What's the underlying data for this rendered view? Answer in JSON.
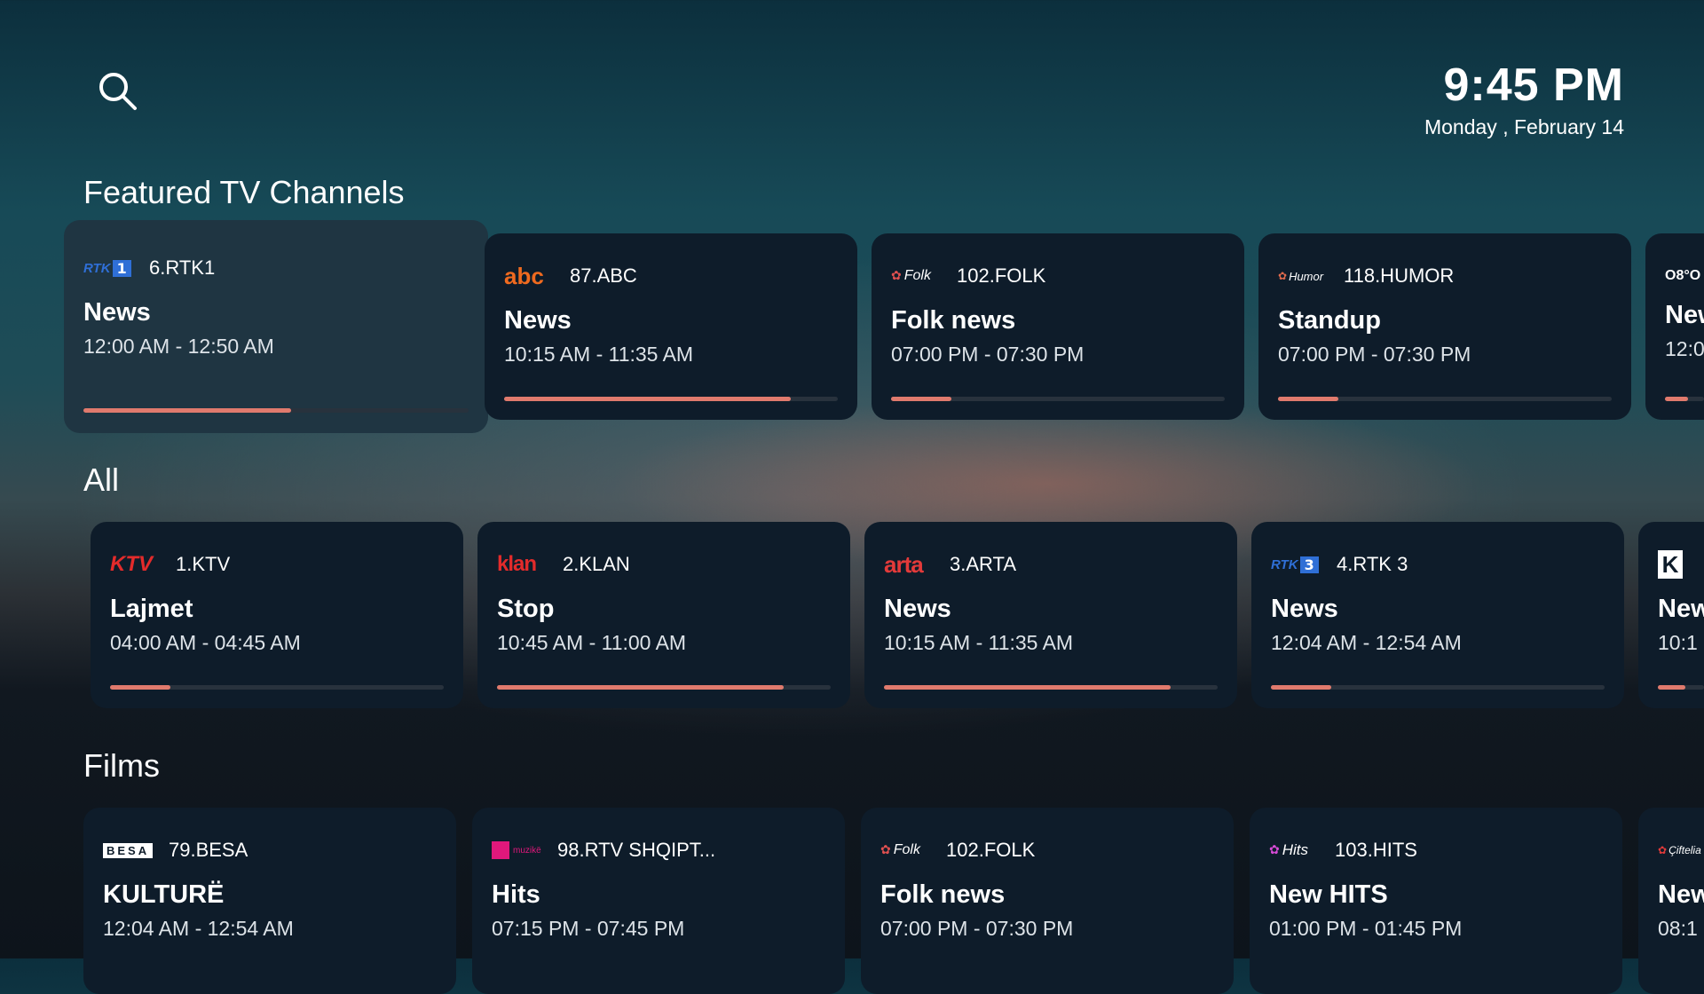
{
  "header": {
    "time": "9:45 PM",
    "date": "Monday , February 14"
  },
  "sections": {
    "featured": {
      "title": "Featured TV Channels",
      "cards": [
        {
          "channel": "6.RTK1",
          "program": "News",
          "times": "12:00 AM - 12:50 AM",
          "progress": 0.54,
          "logo": "rtk1-logo"
        },
        {
          "channel": "87.ABC",
          "program": "News",
          "times": "10:15 AM - 11:35 AM",
          "progress": 0.86,
          "logo": "abc-logo"
        },
        {
          "channel": "102.FOLK",
          "program": "Folk news",
          "times": "07:00 PM - 07:30 PM",
          "progress": 0.18,
          "logo": "folk-logo"
        },
        {
          "channel": "118.HUMOR",
          "program": "Standup",
          "times": "07:00 PM - 07:30 PM",
          "progress": 0.18,
          "logo": "humor-logo"
        },
        {
          "channel": "",
          "program": "New",
          "times": "12:0",
          "progress": 0.6,
          "logo": "oxo-logo"
        }
      ]
    },
    "all": {
      "title": "All",
      "cards": [
        {
          "channel": "1.KTV",
          "program": "Lajmet",
          "times": "04:00 AM - 04:45 AM",
          "progress": 0.18,
          "logo": "ktv-logo"
        },
        {
          "channel": "2.KLAN",
          "program": "Stop",
          "times": "10:45 AM - 11:00 AM",
          "progress": 0.86,
          "logo": "klan-logo"
        },
        {
          "channel": "3.ARTA",
          "program": "News",
          "times": "10:15 AM - 11:35 AM",
          "progress": 0.86,
          "logo": "arta-logo"
        },
        {
          "channel": "4.RTK 3",
          "program": "News",
          "times": "12:04 AM - 12:54 AM",
          "progress": 0.18,
          "logo": "rtk3-logo"
        },
        {
          "channel": "",
          "program": "New",
          "times": "10:1",
          "progress": 0.6,
          "logo": "k-logo"
        }
      ]
    },
    "films": {
      "title": "Films",
      "cards": [
        {
          "channel": "79.BESA",
          "program": "KULTURË",
          "times": "12:04 AM - 12:54 AM",
          "logo": "besa-logo"
        },
        {
          "channel": "98.RTV SHQIPT...",
          "program": "Hits",
          "times": "07:15 PM - 07:45 PM",
          "logo": "rtv-muzike-logo"
        },
        {
          "channel": "102.FOLK",
          "program": "Folk news",
          "times": "07:00 PM - 07:30 PM",
          "logo": "folk-logo"
        },
        {
          "channel": "103.HITS",
          "program": "New HITS",
          "times": "01:00 PM - 01:45 PM",
          "logo": "hits-logo"
        },
        {
          "channel": "",
          "program": "New",
          "times": "08:1",
          "logo": "ciftelia-logo"
        }
      ]
    }
  },
  "logos": {
    "rtk1": "RTK",
    "rtk1_num": "1",
    "abc": "abc",
    "folk": "Folk",
    "humor": "Humor",
    "ktv": "KTV",
    "klan": "klan",
    "arta": "arta",
    "rtk3": "RTK",
    "rtk3_num": "3",
    "besa": "BESA",
    "rtv": "muzikë",
    "hits": "Hits",
    "ciftelia": "Çiftelia",
    "oxo": "O8°O"
  },
  "colors": {
    "accent": "#e07a6d",
    "card": "#0e1c2a",
    "card_focused": "#1f3542"
  }
}
